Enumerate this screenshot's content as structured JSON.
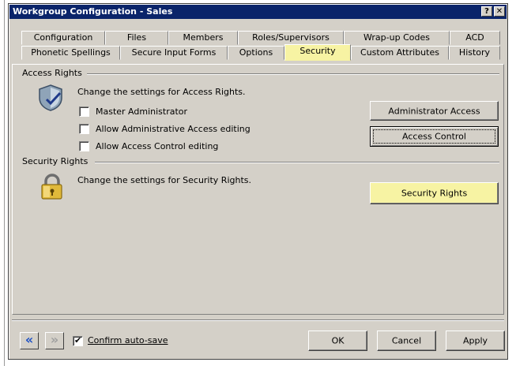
{
  "window": {
    "title": "Workgroup Configuration - Sales",
    "help_btn": "?",
    "close_btn": "✕"
  },
  "tabs_row1": [
    "Configuration",
    "Files",
    "Members",
    "Roles/Supervisors",
    "Wrap-up Codes",
    "ACD"
  ],
  "tabs_row2": [
    "Phonetic Spellings",
    "Secure Input Forms",
    "Options",
    "Security",
    "Custom Attributes",
    "History"
  ],
  "active_tab": "Security",
  "access_rights": {
    "heading": "Access Rights",
    "description": "Change the settings for Access Rights.",
    "checkboxes": [
      {
        "label": "Master Administrator",
        "checked": false
      },
      {
        "label": "Allow Administrative Access editing",
        "checked": false
      },
      {
        "label": "Allow Access Control editing",
        "checked": false
      }
    ],
    "admin_button": "Administrator Access",
    "access_control_button": "Access Control"
  },
  "security_rights": {
    "heading": "Security Rights",
    "description": "Change the settings for Security Rights.",
    "button": "Security Rights"
  },
  "footer": {
    "back_icon": "«",
    "forward_icon": "»",
    "confirm_autosave": "Confirm auto-save",
    "confirm_autosave_checked": true,
    "ok": "OK",
    "cancel": "Cancel",
    "apply": "Apply"
  },
  "colors": {
    "highlight": "#f7f3a3",
    "titlebar": "#0a246a",
    "face": "#d4d0c8"
  }
}
